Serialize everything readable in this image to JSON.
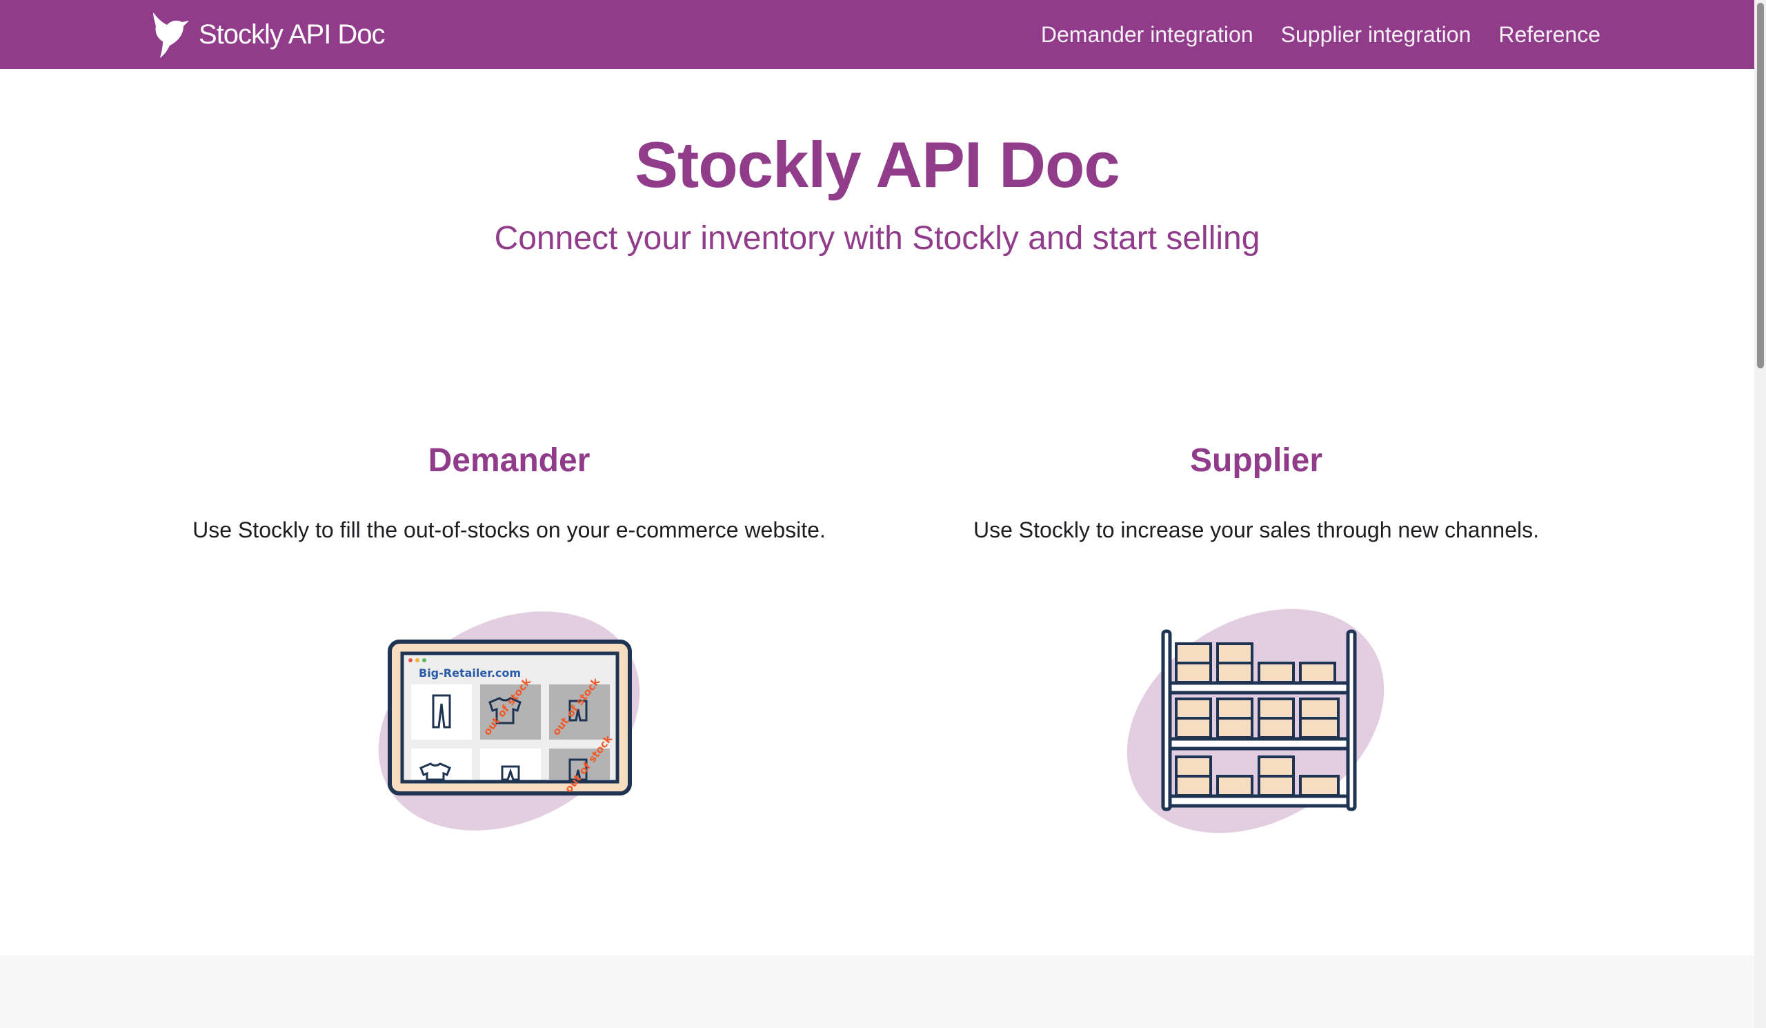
{
  "navbar": {
    "brand_title": "Stockly API Doc",
    "links": [
      "Demander integration",
      "Supplier integration",
      "Reference"
    ],
    "background": "#903c8b"
  },
  "hero": {
    "title": "Stockly API Doc",
    "subtitle": "Connect your inventory with Stockly and start selling"
  },
  "features": [
    {
      "title": "Demander",
      "description": "Use Stockly to fill the out-of-stocks on your e-commerce website.",
      "illustration": {
        "site_label": "Big-Retailer.com",
        "badge_text": "out of stock"
      }
    },
    {
      "title": "Supplier",
      "description": "Use Stockly to increase your sales through new channels."
    }
  ],
  "icons": {
    "brand": "hummingbird-logo-icon",
    "demander": "retailer-website-illustration",
    "supplier": "warehouse-shelf-illustration"
  },
  "colors": {
    "accent": "#903c8b",
    "blob": "#e2cde1",
    "navy": "#1f3452",
    "box": "#f6dcc0",
    "footer": "#f7f7f7"
  }
}
